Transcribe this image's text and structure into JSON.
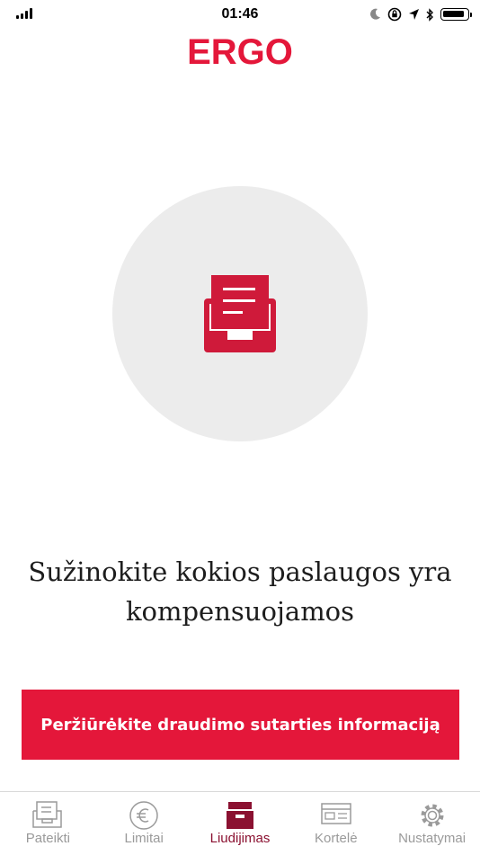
{
  "status_bar": {
    "time": "01:46"
  },
  "brand": {
    "logo_text": "ERGO",
    "accent_color": "#e4173a",
    "active_color": "#8b1131"
  },
  "hero": {
    "icon": "document-tray-icon"
  },
  "main": {
    "headline_line1": "Sužinokite kokios paslaugos yra",
    "headline_line2": "kompensuojamos",
    "cta_label": "Peržiūrėkite draudimo sutarties informaciją"
  },
  "tabs": [
    {
      "label": "Pateikti",
      "icon": "submit-tray-icon",
      "active": false
    },
    {
      "label": "Limitai",
      "icon": "euro-icon",
      "active": false
    },
    {
      "label": "Liudijimas",
      "icon": "certificate-box-icon",
      "active": true
    },
    {
      "label": "Kortelė",
      "icon": "card-icon",
      "active": false
    },
    {
      "label": "Nustatymai",
      "icon": "gear-icon",
      "active": false
    }
  ]
}
